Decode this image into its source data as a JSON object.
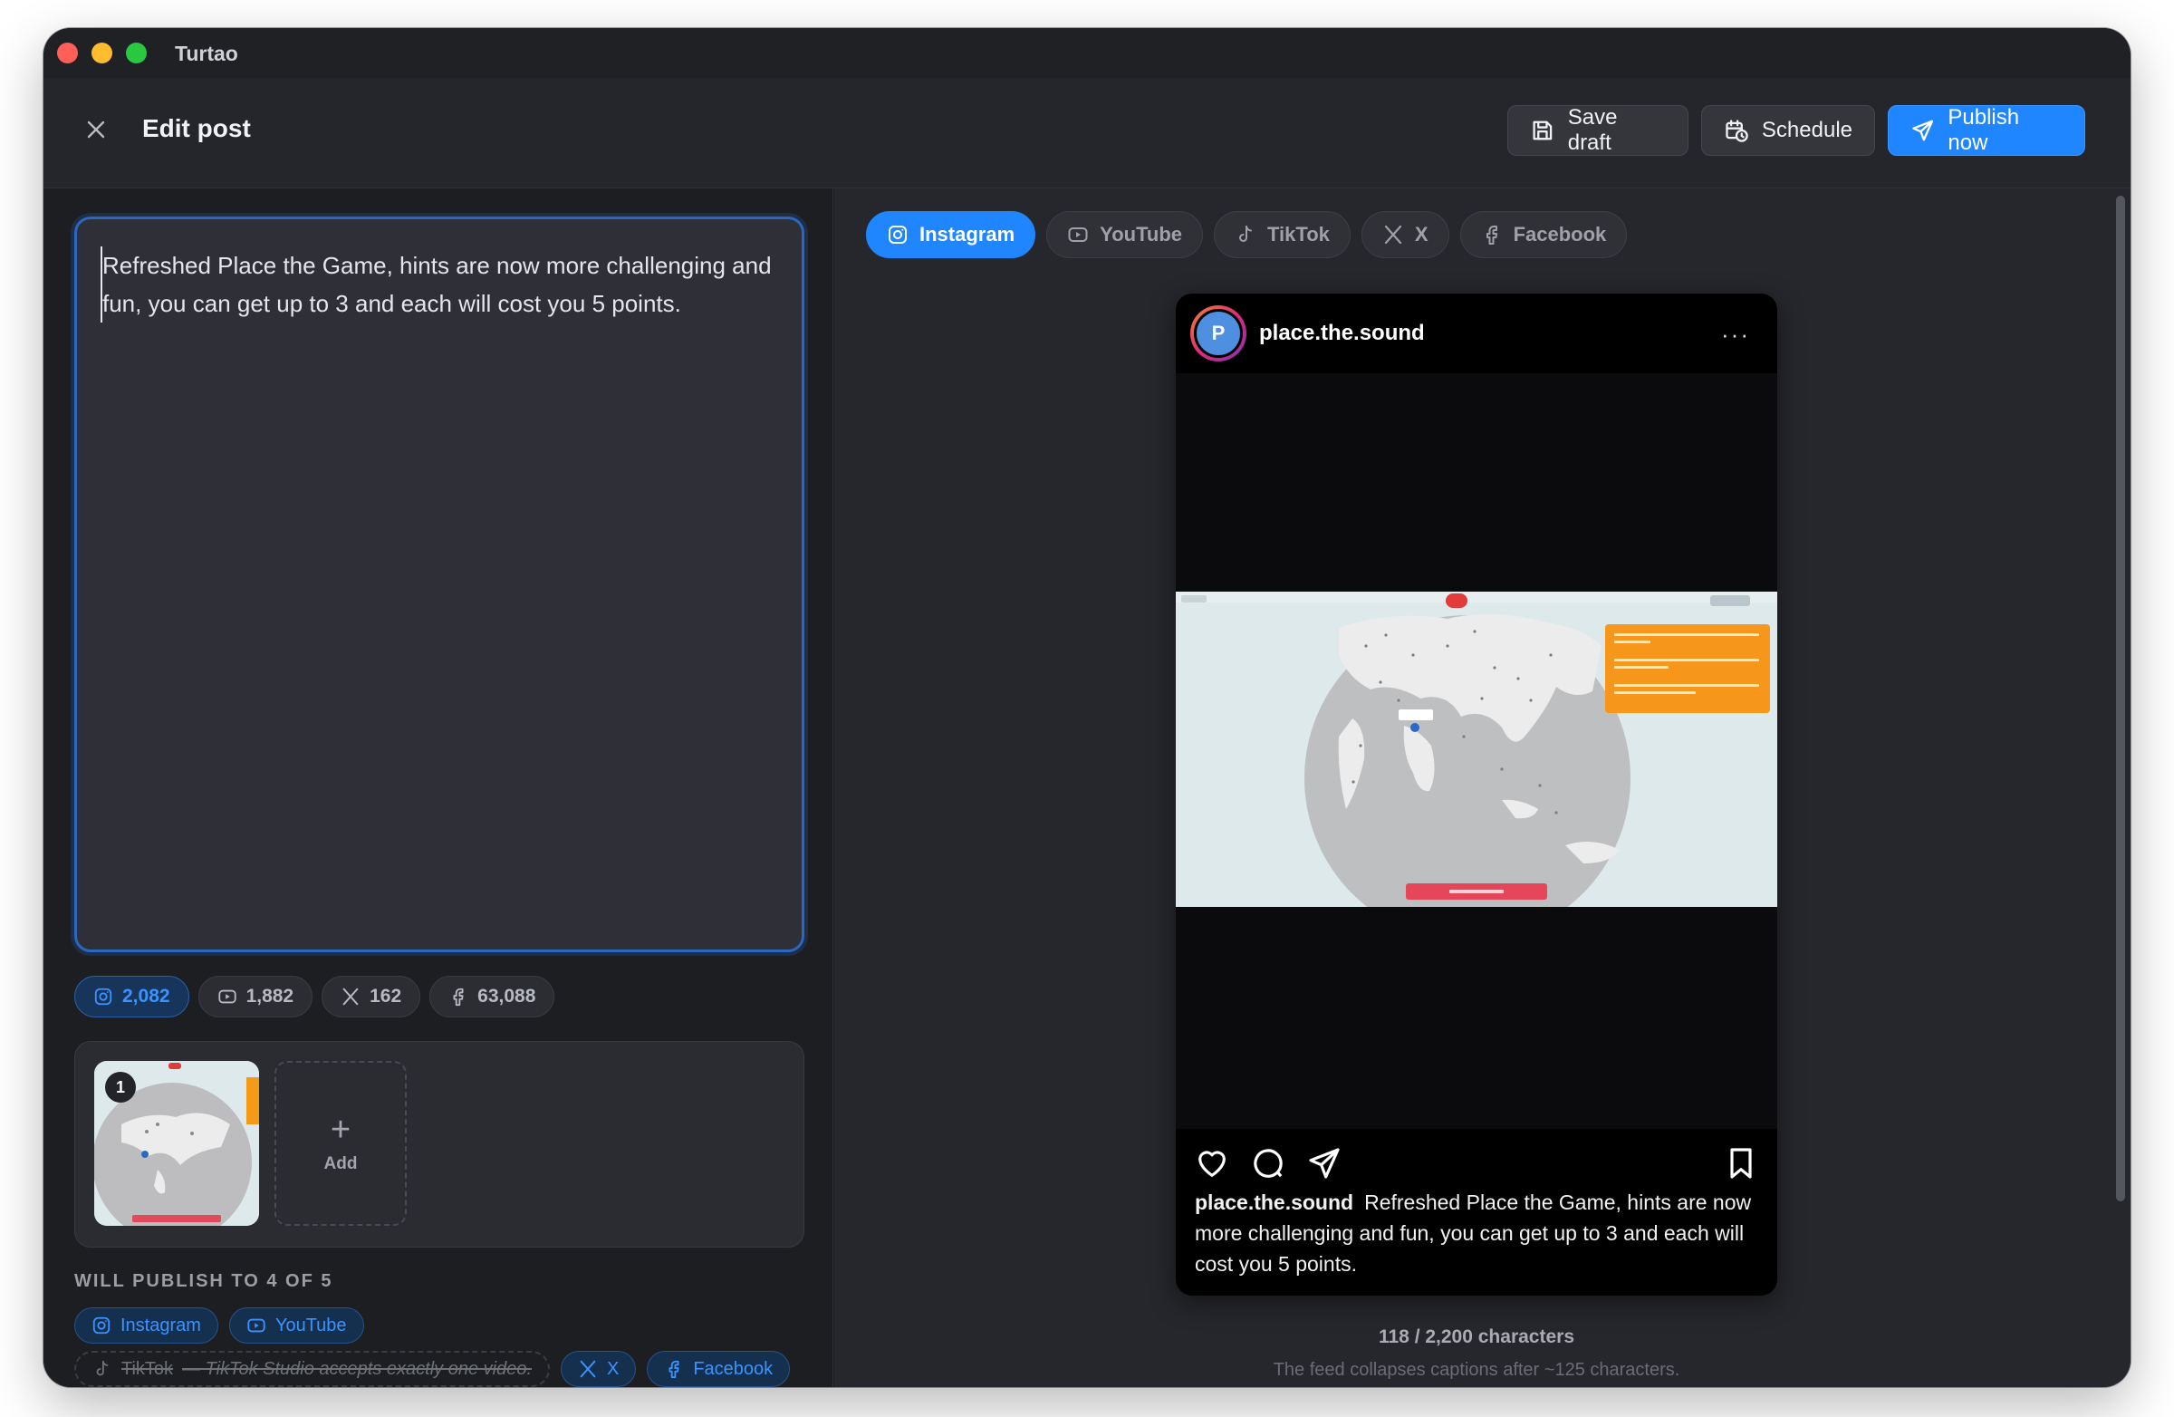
{
  "app": {
    "title": "Turtao"
  },
  "header": {
    "title": "Edit post",
    "save_label": "Save draft",
    "schedule_label": "Schedule",
    "publish_label": "Publish now"
  },
  "editor": {
    "text": "Refreshed Place the Game, hints are now more challenging and fun, you can get up to 3 and each will cost you 5 points."
  },
  "counts": [
    {
      "platform": "Instagram",
      "value": "2,082",
      "icon": "instagram-icon",
      "active": true
    },
    {
      "platform": "YouTube",
      "value": "1,882",
      "icon": "youtube-icon",
      "active": false
    },
    {
      "platform": "X",
      "value": "162",
      "icon": "x-icon",
      "active": false
    },
    {
      "platform": "Facebook",
      "value": "63,088",
      "icon": "facebook-icon",
      "active": false
    }
  ],
  "media": {
    "items": [
      {
        "index": "1"
      }
    ],
    "add_label": "Add",
    "add_icon": "plus-icon"
  },
  "publish": {
    "label": "WILL PUBLISH TO 4 OF 5",
    "instagram": "Instagram",
    "youtube": "YouTube",
    "tiktok": "TikTok",
    "tiktok_reason": "— TikTok Studio accepts exactly one video.",
    "x": "X",
    "facebook": "Facebook"
  },
  "preview": {
    "tabs": [
      {
        "label": "Instagram",
        "icon": "instagram-icon",
        "active": true
      },
      {
        "label": "YouTube",
        "icon": "youtube-icon",
        "active": false
      },
      {
        "label": "TikTok",
        "icon": "tiktok-icon",
        "active": false
      },
      {
        "label": "X",
        "icon": "x-icon",
        "active": false
      },
      {
        "label": "Facebook",
        "icon": "facebook-icon",
        "active": false
      }
    ],
    "avatar_letter": "P",
    "username": "place.the.sound",
    "more": "···",
    "caption": "Refreshed Place the Game, hints are now more challenging and fun, you can get up to 3 and each will cost you 5 points.",
    "char_count": "118 / 2,200 characters",
    "note": "The feed collapses captions after ~125 characters."
  },
  "colors": {
    "accent": "#1f86ff",
    "background": "#1b1c20",
    "panel": "#26272c"
  }
}
